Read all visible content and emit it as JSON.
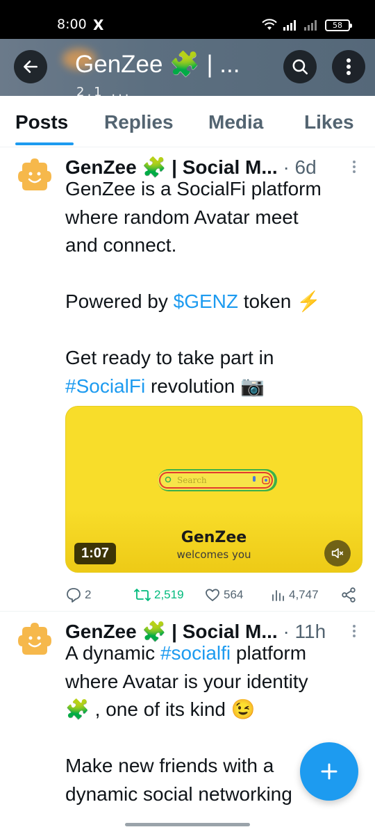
{
  "status_bar": {
    "time": "8:00",
    "x_icon": "X",
    "battery": "58"
  },
  "header": {
    "title": "GenZee 🧩 | ...",
    "subtitle": "2,1 ...",
    "back_icon": "arrow-left-icon",
    "search_icon": "search-icon",
    "more_icon": "more-vertical-icon",
    "background": "#5c6f80"
  },
  "tabs": [
    {
      "label": "Posts",
      "active": true
    },
    {
      "label": "Replies",
      "active": false
    },
    {
      "label": "Media",
      "active": false
    },
    {
      "label": "Likes",
      "active": false
    }
  ],
  "posts": [
    {
      "name": "GenZee 🧩 | Social M...",
      "time": "· 6d",
      "body": {
        "line1": "GenZee is a SocialFi platform",
        "line2": "where random Avatar meet",
        "line3": "and connect.",
        "line4_pre": "Powered by ",
        "line4_link": "$GENZ",
        "line4_post": " token ⚡",
        "line5": "Get ready to take part in",
        "line6_link": "#SocialFi",
        "line6_post": " revolution 📷"
      },
      "media": {
        "search_placeholder": "Search",
        "brand": "GenZee",
        "tagline": "welcomes you",
        "duration": "1:07",
        "mute_icon": "volume-mute-icon"
      },
      "stats": {
        "replies": "2",
        "reposts": "2,519",
        "likes": "564",
        "views": "4,747"
      }
    },
    {
      "name": "GenZee 🧩 | Social M...",
      "time": "· 11h",
      "body": {
        "line1_pre": "A dynamic ",
        "line1_link": "#socialfi",
        "line1_post": " platform",
        "line2": "where Avatar is your identity",
        "line3": "🧩 , one of its kind 😉",
        "line4": "Make new friends with a",
        "line5": "dynamic social networking"
      }
    }
  ],
  "fab": {
    "icon": "plus-icon"
  },
  "colors": {
    "accent": "#1d9bf0",
    "repost": "#00ba7c",
    "media_bg": "#f8dd2a"
  }
}
